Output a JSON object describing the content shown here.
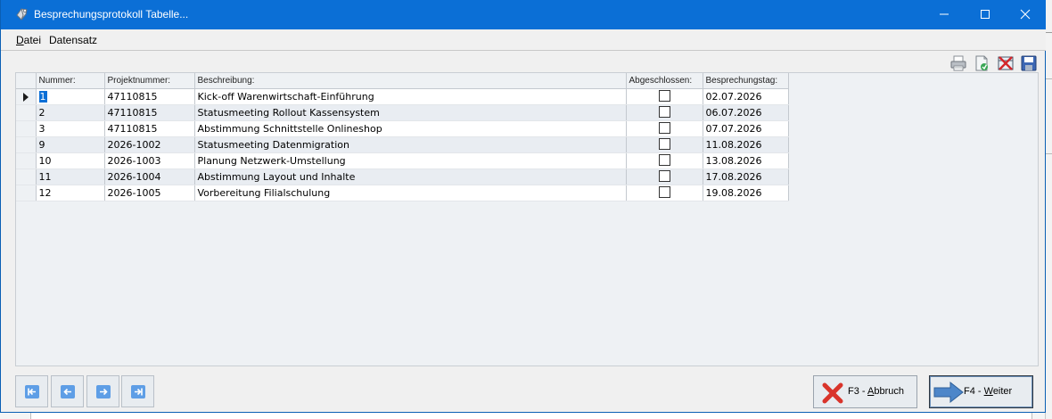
{
  "window": {
    "title": "Besprechungsprotokoll Tabelle..."
  },
  "menu": [
    {
      "label": "Datei",
      "accel": "D",
      "rest": "atei"
    },
    {
      "label": "Datensatz",
      "accel": "",
      "rest": "Datensatz"
    }
  ],
  "toolbar": {
    "icons": [
      "print-icon",
      "new-record-icon",
      "delete-record-icon",
      "save-icon"
    ]
  },
  "grid": {
    "columns": [
      "Nummer:",
      "Projektnummer:",
      "Beschreibung:",
      "Abgeschlossen:",
      "Besprechungstag:"
    ],
    "rows": [
      {
        "nummer": "1",
        "projekt": "47110815",
        "beschreibung": "Kick-off Warenwirtschaft-Einführung",
        "abgeschlossen": false,
        "tag": "02.07.2026",
        "current": true
      },
      {
        "nummer": "2",
        "projekt": "47110815",
        "beschreibung": "Statusmeeting Rollout Kassensystem",
        "abgeschlossen": false,
        "tag": "06.07.2026"
      },
      {
        "nummer": "3",
        "projekt": "47110815",
        "beschreibung": "Abstimmung Schnittstelle Onlineshop",
        "abgeschlossen": false,
        "tag": "07.07.2026"
      },
      {
        "nummer": "9",
        "projekt": "2026-1002",
        "beschreibung": "Statusmeeting Datenmigration",
        "abgeschlossen": false,
        "tag": "11.08.2026"
      },
      {
        "nummer": "10",
        "projekt": "2026-1003",
        "beschreibung": "Planung Netzwerk-Umstellung",
        "abgeschlossen": false,
        "tag": "13.08.2026"
      },
      {
        "nummer": "11",
        "projekt": "2026-1004",
        "beschreibung": "Abstimmung Layout und Inhalte",
        "abgeschlossen": false,
        "tag": "17.08.2026"
      },
      {
        "nummer": "12",
        "projekt": "2026-1005",
        "beschreibung": "Vorbereitung Filialschulung",
        "abgeschlossen": false,
        "tag": "19.08.2026"
      }
    ]
  },
  "navigation": {
    "buttons": [
      "first-record-button",
      "previous-record-button",
      "next-record-button",
      "last-record-button"
    ]
  },
  "actions": {
    "cancel": {
      "prefix": "F3 - ",
      "accel": "A",
      "rest": "bbruch"
    },
    "next": {
      "prefix": "F4 - ",
      "accel": "W",
      "rest": "eiter"
    }
  },
  "colors": {
    "titlebar": "#0b6fd6",
    "selection": "#0b6fd6",
    "cancel_icon": "#d9342b",
    "next_arrow": "#4d86c9"
  }
}
